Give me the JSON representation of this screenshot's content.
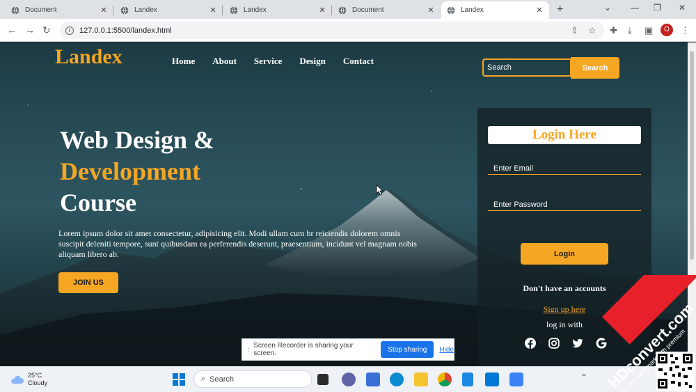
{
  "browser": {
    "tabs": [
      {
        "title": "Document"
      },
      {
        "title": "Landex"
      },
      {
        "title": "Landex"
      },
      {
        "title": "Document"
      },
      {
        "title": "Landex",
        "active": true
      }
    ],
    "url": "127.0.0.1:5500/landex.html",
    "avatar_letter": "O"
  },
  "site": {
    "logo": "Landex",
    "nav": [
      "Home",
      "About",
      "Service",
      "Design",
      "Contact"
    ],
    "search": {
      "placeholder": "Search",
      "button": "Search"
    },
    "hero": {
      "line1": "Web Design &",
      "line2": "Development",
      "line3": "Course",
      "text": "Lorem ipsum dolor sit amet consectetur, adipisicing elit. Modi ullam cum br reiciendis dolorem omnis suscipit deleniti tempore, sunt quibusdam ea perferendis deserunt, praesentium, incidunt vel magnam nobis aliquam libero ab.",
      "button": "JOIN US"
    },
    "login": {
      "title": "Login Here",
      "email_placeholder": "Enter Email",
      "password_placeholder": "Enter Password",
      "button": "Login",
      "no_account": "Don't have an accounts",
      "signup": "Sign up here",
      "login_with": "log in with",
      "social": [
        "facebook-icon",
        "instagram-icon",
        "twitter-icon",
        "google-icon"
      ]
    }
  },
  "share_bar": {
    "message": "Screen Recorder is sharing your screen.",
    "stop": "Stop sharing",
    "hide": "Hide"
  },
  "taskbar": {
    "temp": "25°C",
    "condition": "Cloudy",
    "search": "Search"
  },
  "watermark": {
    "brand": "HDconvert.com",
    "sub": "remove watermark with premium"
  },
  "colors": {
    "accent": "#f5a623",
    "chrome_blue": "#1a73e8"
  }
}
